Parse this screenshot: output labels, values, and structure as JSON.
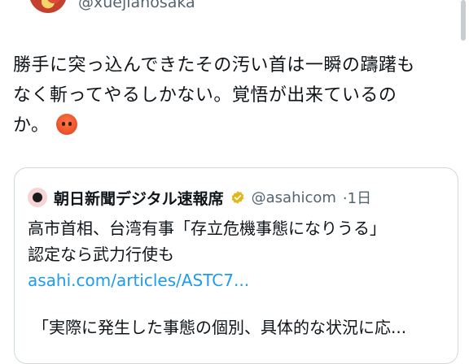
{
  "author": {
    "handle": "@xuejianosaka"
  },
  "tweet": {
    "line1": "勝手に突っ込んできたその汚い首は一瞬の躊躇も",
    "line2": "なく斬ってやるしかない。覚悟が出来ているの",
    "line3": "か。"
  },
  "quoted": {
    "name": "朝日新聞デジタル速報席",
    "handle": "@asahicom",
    "time": "·1日",
    "line1": "高市首相、台湾有事「存立危機事態になりうる」",
    "line2": "認定なら武力行使も",
    "link": "asahi.com/articles/ASTC7...",
    "extra": "「実際に発生した事態の個別、具体的な状況に応..."
  },
  "colors": {
    "link": "#1d9bf0",
    "verified": "#e2b719",
    "secondary": "#536471"
  }
}
